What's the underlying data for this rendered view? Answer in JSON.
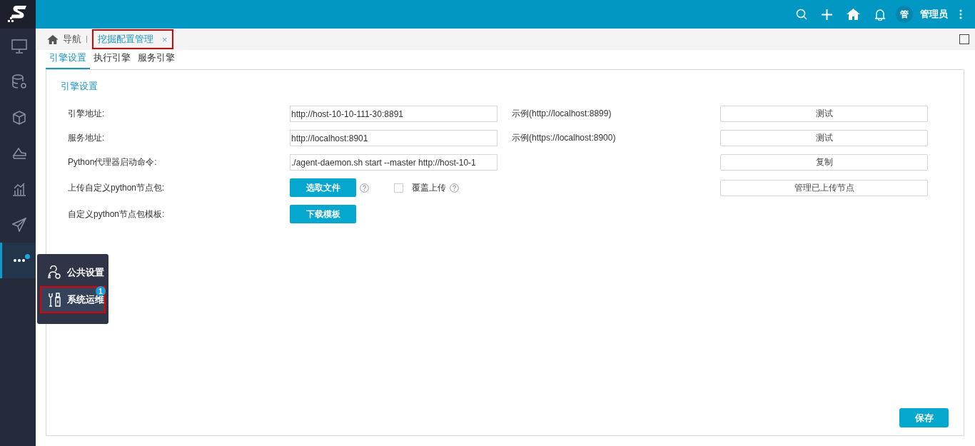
{
  "topbar": {
    "avatar": "管",
    "user": "管理员"
  },
  "sidebar": {
    "items": [
      {
        "kind": "monitor",
        "selected": false,
        "dot": false
      },
      {
        "kind": "database",
        "selected": false,
        "dot": false
      },
      {
        "kind": "cube",
        "selected": false,
        "dot": false
      },
      {
        "kind": "layers",
        "selected": false,
        "dot": false
      },
      {
        "kind": "chart",
        "selected": false,
        "dot": false
      },
      {
        "kind": "send",
        "selected": false,
        "dot": false
      },
      {
        "kind": "more",
        "selected": true,
        "dot": true
      }
    ]
  },
  "tabbar": {
    "home": "导航",
    "tabs": [
      {
        "label": "挖掘配置管理",
        "selected": true,
        "highlighted": true,
        "close": "×"
      }
    ]
  },
  "subtabs": [
    {
      "label": "引擎设置",
      "selected": true
    },
    {
      "label": "执行引擎",
      "selected": false
    },
    {
      "label": "服务引擎",
      "selected": false
    }
  ],
  "section_title": "引擎设置",
  "rows": [
    {
      "kind": "field",
      "label": "引擎地址:",
      "value": "http://host-10-10-111-30:8891",
      "hint": "示例(http://localhost:8899)",
      "button": "测试"
    },
    {
      "kind": "field",
      "label": "服务地址:",
      "value": "http://localhost:8901",
      "hint": "示例(https://localhost:8900)",
      "button": "测试"
    },
    {
      "kind": "field",
      "label": "Python代理器启动命令:",
      "value": "./agent-daemon.sh start --master http://host-10-1",
      "button": "复制"
    },
    {
      "kind": "upload",
      "label": "上传自定义python节点包:",
      "action": "选取文件",
      "checkbox": {
        "label": "覆盖上传",
        "checked": false
      },
      "button": "管理已上传节点"
    },
    {
      "kind": "template",
      "label": "自定义python节点包模板:",
      "action": "下载模板"
    }
  ],
  "save_button": "保存",
  "popup_menu": {
    "items": [
      {
        "kind": "gear-person",
        "label": "公共设置",
        "highlighted": false
      },
      {
        "kind": "tools",
        "label": "系统运维",
        "highlighted": true,
        "badge": "1"
      }
    ]
  }
}
